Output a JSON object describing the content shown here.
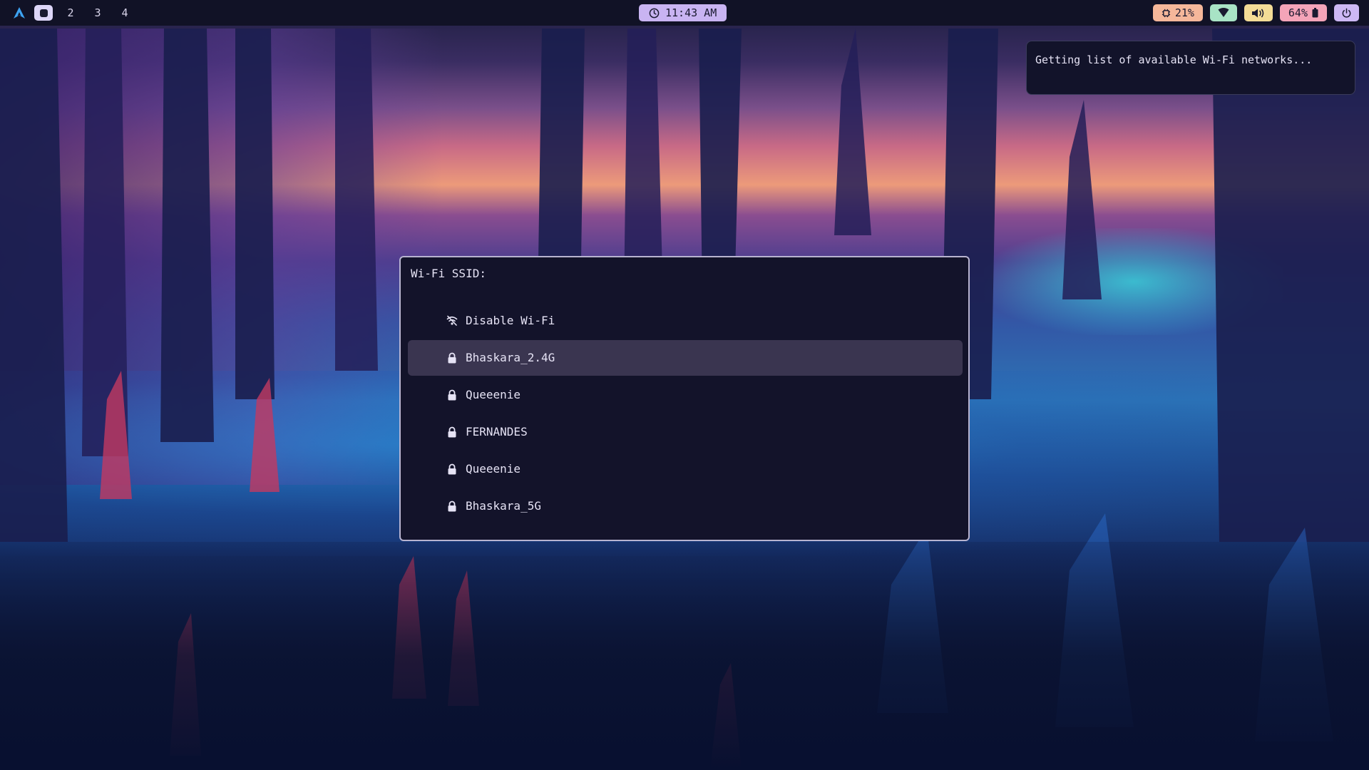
{
  "topbar": {
    "launcher_icon": "arch-logo-icon",
    "workspaces": [
      "2",
      "3",
      "4"
    ],
    "clock": "11:43 AM",
    "cpu": "21%",
    "battery": "64%",
    "icons": {
      "clock": "clock-icon",
      "cpu": "cpu-icon",
      "wifi": "wifi-icon",
      "volume": "volume-icon",
      "battery": "battery-icon",
      "power": "power-icon"
    }
  },
  "notification": {
    "text": "Getting list of available Wi-Fi networks..."
  },
  "wifi_menu": {
    "prompt": "Wi-Fi SSID:",
    "items": [
      {
        "label": "Disable Wi-Fi",
        "icon": "wifi-off-icon",
        "selected": false
      },
      {
        "label": "Bhaskara_2.4G",
        "icon": "lock-icon",
        "selected": true
      },
      {
        "label": "Queeenie",
        "icon": "lock-icon",
        "selected": false
      },
      {
        "label": "FERNANDES",
        "icon": "lock-icon",
        "selected": false
      },
      {
        "label": "Queeenie",
        "icon": "lock-icon",
        "selected": false
      },
      {
        "label": "Bhaskara_5G",
        "icon": "lock-icon",
        "selected": false
      }
    ]
  },
  "colors": {
    "bar_background": "#111226",
    "clock_pill": "#c9b4f2",
    "cpu_pill": "#f5b79a",
    "wifi_pill": "#a8e3c5",
    "volume_pill": "#f4dc96",
    "battery_pill": "#f4a4b8",
    "power_pill": "#cdb8f4",
    "menu_background": "#13132a",
    "menu_selected": "#3a3550"
  }
}
